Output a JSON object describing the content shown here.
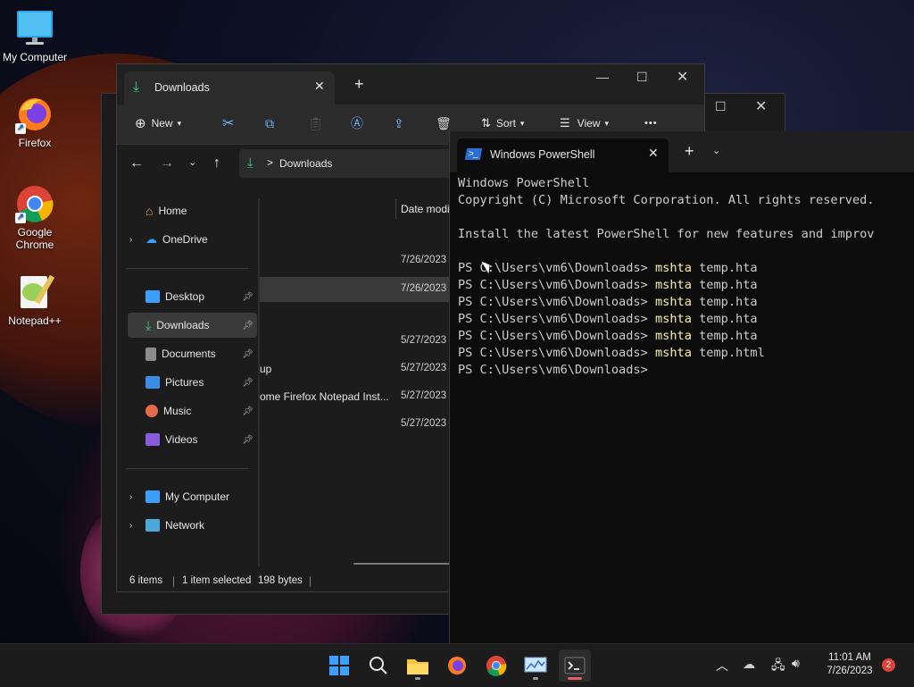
{
  "desktop": {
    "icons": [
      {
        "label": "My Computer",
        "icon": "monitor-icon"
      },
      {
        "label": "Firefox",
        "icon": "firefox-icon"
      },
      {
        "label": "Google Chrome",
        "icon": "chrome-icon"
      },
      {
        "label": "Notepad++",
        "icon": "notepadpp-icon"
      }
    ]
  },
  "explorer": {
    "tab_title": "Downloads",
    "new_tab": "+",
    "toolbar": {
      "new_label": "New",
      "sort_label": "Sort",
      "view_label": "View",
      "more": "•••"
    },
    "address": {
      "path_label": "Downloads",
      "separator": ">"
    },
    "column_header": "Date modi",
    "nav": {
      "home": "Home",
      "onedrive": "OneDrive",
      "desktop": "Desktop",
      "downloads": "Downloads",
      "documents": "Documents",
      "pictures": "Pictures",
      "music": "Music",
      "videos": "Videos",
      "my_computer": "My Computer",
      "network": "Network"
    },
    "rows": [
      {
        "name": "",
        "date": "7/26/2023"
      },
      {
        "name": "",
        "date": "7/26/2023"
      },
      {
        "name": "",
        "date": "5/27/2023"
      },
      {
        "name": "up",
        "date": "5/27/2023"
      },
      {
        "name": "ome Firefox Notepad Inst...",
        "date": "5/27/2023"
      },
      {
        "name": "",
        "date": "5/27/2023"
      }
    ],
    "status": {
      "items": "6 items",
      "selected": "1 item selected",
      "size": "198 bytes"
    }
  },
  "powershell": {
    "tab_title": "Windows PowerShell",
    "new_tab": "+",
    "lines": {
      "l1": "Windows PowerShell",
      "l2": "Copyright (C) Microsoft Corporation. All rights reserved.",
      "l3": "Install the latest PowerShell for new features and improv",
      "prompt": "PS C:\\Users\\vm6\\Downloads> ",
      "cmd": "mshta",
      "arg1": " temp.hta",
      "arg2": " temp.html"
    }
  },
  "taskbar": {
    "time": "11:01 AM",
    "date": "7/26/2023",
    "notification_count": "2"
  },
  "colors": {
    "accent": "#4cc2ff",
    "download_green": "#3ec97a",
    "ps_command": "#f9f1a5",
    "badge_red": "#e0423a"
  }
}
